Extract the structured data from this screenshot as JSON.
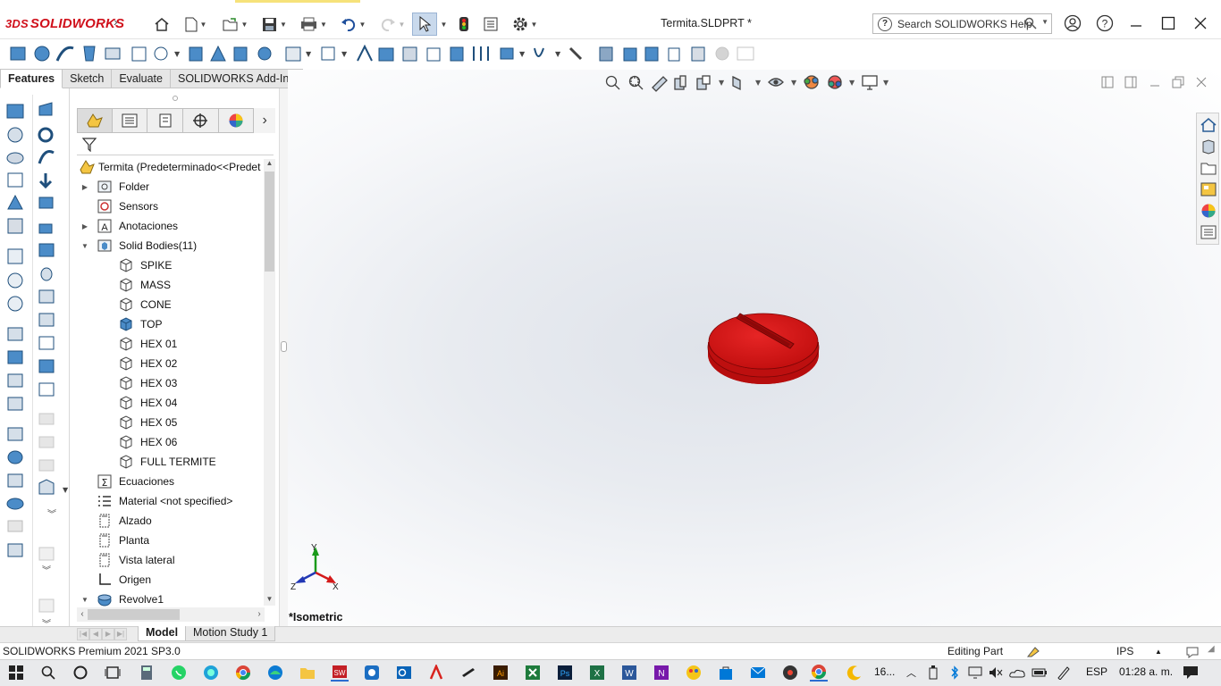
{
  "app": {
    "brand_prefix": "3DS",
    "brand_name": "SOLIDWORKS",
    "document_title": "Termita.SLDPRT *",
    "help_search_placeholder": "Search SOLIDWORKS Help"
  },
  "tabs": [
    "Features",
    "Sketch",
    "Evaluate",
    "SOLIDWORKS Add-Ins"
  ],
  "feature_tree": {
    "root_label": "Termita  (Predeterminado<<Predet",
    "items": [
      {
        "label": "Folder",
        "icon": "folder-icon",
        "expander": "collapsed",
        "indent": 0
      },
      {
        "label": "Sensors",
        "icon": "sensor-icon",
        "expander": "",
        "indent": 0
      },
      {
        "label": "Anotaciones",
        "icon": "annotation-icon",
        "expander": "collapsed",
        "indent": 0
      },
      {
        "label": "Solid Bodies(11)",
        "icon": "solid-bodies-folder-icon",
        "expander": "expanded",
        "indent": 0
      },
      {
        "label": "SPIKE",
        "icon": "solid-body-icon",
        "expander": "",
        "indent": 1
      },
      {
        "label": "MASS",
        "icon": "solid-body-icon",
        "expander": "",
        "indent": 1
      },
      {
        "label": "CONE",
        "icon": "solid-body-icon",
        "expander": "",
        "indent": 1
      },
      {
        "label": "TOP",
        "icon": "solid-body-selected-icon",
        "expander": "",
        "indent": 1
      },
      {
        "label": "HEX 01",
        "icon": "solid-body-icon",
        "expander": "",
        "indent": 1
      },
      {
        "label": "HEX 02",
        "icon": "solid-body-icon",
        "expander": "",
        "indent": 1
      },
      {
        "label": "HEX 03",
        "icon": "solid-body-icon",
        "expander": "",
        "indent": 1
      },
      {
        "label": "HEX 04",
        "icon": "solid-body-icon",
        "expander": "",
        "indent": 1
      },
      {
        "label": "HEX 05",
        "icon": "solid-body-icon",
        "expander": "",
        "indent": 1
      },
      {
        "label": "HEX 06",
        "icon": "solid-body-icon",
        "expander": "",
        "indent": 1
      },
      {
        "label": "FULL TERMITE",
        "icon": "solid-body-icon",
        "expander": "",
        "indent": 1
      },
      {
        "label": "Ecuaciones",
        "icon": "equations-icon",
        "expander": "",
        "indent": 0
      },
      {
        "label": "Material <not specified>",
        "icon": "material-icon",
        "expander": "",
        "indent": 0
      },
      {
        "label": "Alzado",
        "icon": "plane-icon",
        "expander": "",
        "indent": 0
      },
      {
        "label": "Planta",
        "icon": "plane-icon",
        "expander": "",
        "indent": 0
      },
      {
        "label": "Vista lateral",
        "icon": "plane-icon",
        "expander": "",
        "indent": 0
      },
      {
        "label": "Origen",
        "icon": "origin-icon",
        "expander": "",
        "indent": 0
      },
      {
        "label": "Revolve1",
        "icon": "revolve-icon",
        "expander": "expanded",
        "indent": 0
      }
    ]
  },
  "viewport": {
    "view_name": "*Isometric",
    "triad_labels": {
      "y": "Y",
      "z": "Z",
      "x": "X"
    },
    "part_color": "#d81414"
  },
  "model_tabs": [
    "Model",
    "Motion Study 1"
  ],
  "statusbar": {
    "product": "SOLIDWORKS Premium 2021 SP3.0",
    "mode": "Editing Part",
    "units": "IPS",
    "units_arrow": "▲"
  },
  "taskbar": {
    "weather": "16...",
    "language": "ESP",
    "time": "01:28 a. m."
  },
  "colors": {
    "brand_red": "#d0101b",
    "selection_blue": "#c9d9ec",
    "part_red": "#d81414"
  }
}
